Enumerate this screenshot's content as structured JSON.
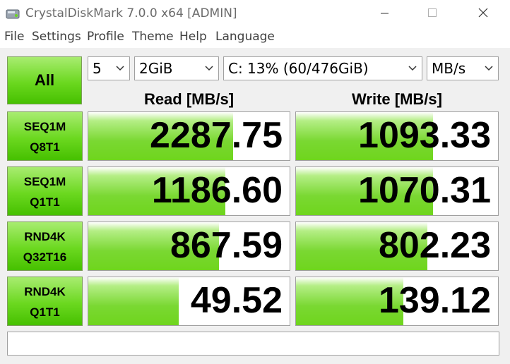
{
  "window": {
    "title": "CrystalDiskMark 7.0.0 x64 [ADMIN]",
    "icons": {
      "app": "disk-app-icon",
      "minimize": "minimize-icon",
      "maximize": "maximize-icon",
      "close": "close-icon"
    }
  },
  "menu": [
    {
      "label": "File"
    },
    {
      "label": "Settings"
    },
    {
      "label": "Profile"
    },
    {
      "label": "Theme"
    },
    {
      "label": "Help"
    },
    {
      "label": "Language"
    }
  ],
  "toolbar": {
    "all_label": "All",
    "count": "5",
    "size": "2GiB",
    "drive": "C: 13% (60/476GiB)",
    "unit": "MB/s"
  },
  "columns": {
    "read": "Read [MB/s]",
    "write": "Write [MB/s]"
  },
  "rows": [
    {
      "line1": "SEQ1M",
      "line2": "Q8T1",
      "read": "2287.75",
      "write": "1093.33",
      "read_fill": 0.72,
      "write_fill": 0.68
    },
    {
      "line1": "SEQ1M",
      "line2": "Q1T1",
      "read": "1186.60",
      "write": "1070.31",
      "read_fill": 0.68,
      "write_fill": 0.68
    },
    {
      "line1": "RND4K",
      "line2": "Q32T16",
      "read": "867.59",
      "write": "802.23",
      "read_fill": 0.65,
      "write_fill": 0.65
    },
    {
      "line1": "RND4K",
      "line2": "Q1T1",
      "read": "49.52",
      "write": "139.12",
      "read_fill": 0.45,
      "write_fill": 0.53
    }
  ],
  "comment": "",
  "colors": {
    "accent_green": "#6bd81f",
    "background": "#f0f0f0",
    "border": "#a0a0a0"
  }
}
